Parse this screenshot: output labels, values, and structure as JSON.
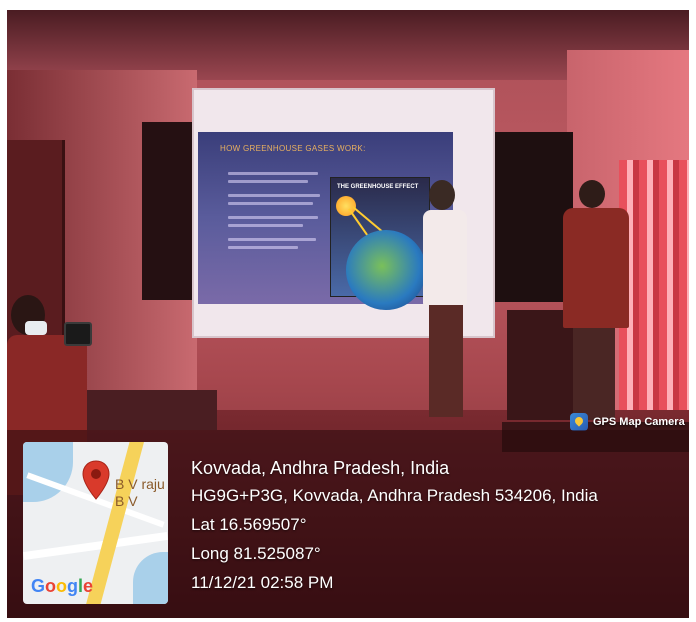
{
  "slide": {
    "title": "HOW GREENHOUSE GASES WORK:",
    "figure_title": "THE GREENHOUSE EFFECT"
  },
  "map": {
    "place_line1": "B V raju",
    "place_line2": "B V",
    "logo": "Google"
  },
  "location": {
    "city": "Kovvada, Andhra Pradesh, India",
    "address": "HG9G+P3G, Kovvada, Andhra Pradesh 534206, India",
    "lat": "Lat 16.569507°",
    "long": "Long 81.525087°",
    "datetime": "11/12/21 02:58 PM"
  },
  "badge": {
    "label": "GPS Map Camera",
    "icon": "gps-map-camera-icon"
  },
  "colors": {
    "room_tint": "#c05c64",
    "google_blue": "#4285f4",
    "google_red": "#ea4335",
    "google_yellow": "#fbbc05",
    "google_green": "#34a853",
    "pin_red": "#d93a2b"
  }
}
